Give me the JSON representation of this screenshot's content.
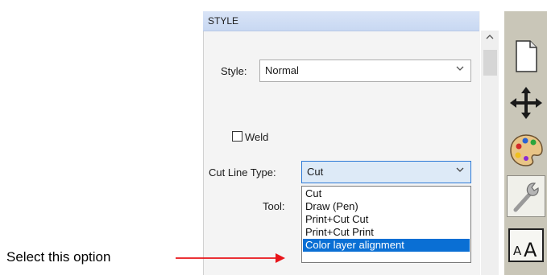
{
  "panel": {
    "title": "STYLE"
  },
  "style_field": {
    "label": "Style:",
    "value": "Normal"
  },
  "weld": {
    "label": "Weld",
    "checked": false
  },
  "cut_line": {
    "label": "Cut Line Type:",
    "value": "Cut"
  },
  "tool": {
    "label": "Tool:"
  },
  "dropdown_options": [
    "Cut",
    "Draw (Pen)",
    "Print+Cut Cut",
    "Print+Cut Print",
    "Color layer alignment"
  ],
  "selected_option": "Color layer alignment",
  "annotation": {
    "text": "Select this option",
    "color": "#e8141a"
  },
  "sidebar_icons": [
    "page-icon",
    "move-icon",
    "palette-icon",
    "wrench-icon",
    "text-size-icon"
  ],
  "colors": {
    "highlight": "#0a6fd4",
    "header": "#c8d8f2"
  }
}
